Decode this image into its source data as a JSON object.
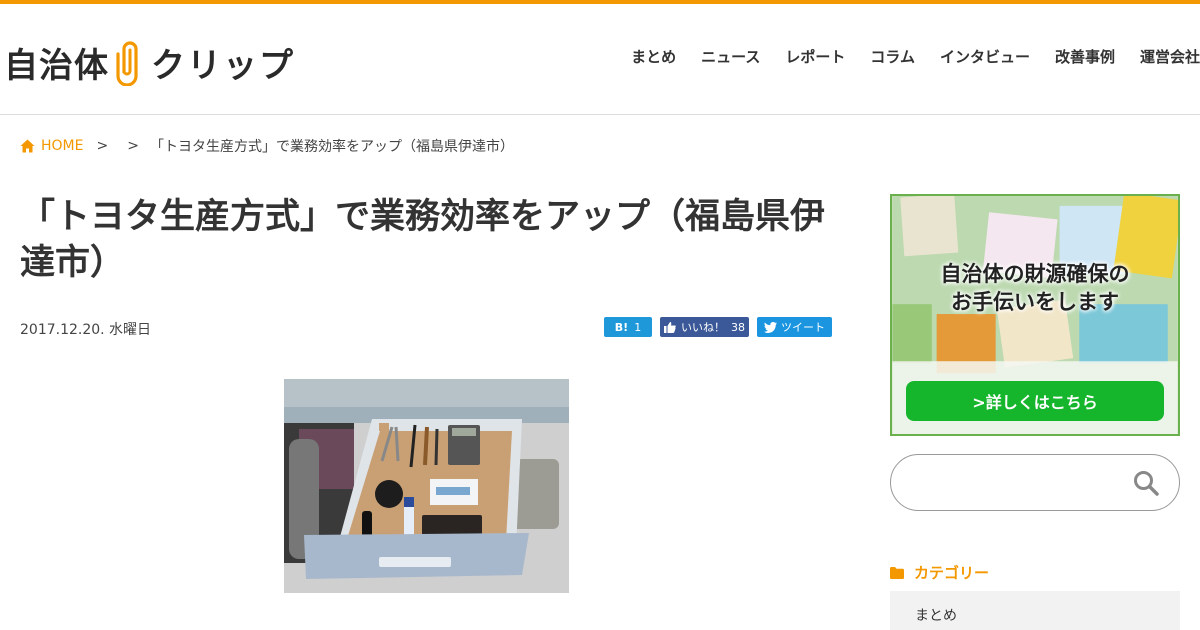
{
  "site": {
    "logo_text_1": "自治体",
    "logo_text_2": "クリップ",
    "accent_color": "#f39800"
  },
  "nav": {
    "items": [
      "まとめ",
      "ニュース",
      "レポート",
      "コラム",
      "インタビュー",
      "改善事例",
      "運営会社"
    ]
  },
  "breadcrumb": {
    "home": "HOME",
    "sep": ">",
    "current": "「トヨタ生産方式」で業務効率をアップ（福島県伊達市）"
  },
  "article": {
    "title": "「トヨタ生産方式」で業務効率をアップ（福島県伊達市）",
    "date": "2017.12.20. 水曜日"
  },
  "share": {
    "hatena_label": "B!",
    "hatena_count": "1",
    "fb_label": "いいね！",
    "fb_count": "38",
    "tw_label": "ツイート"
  },
  "sidebar": {
    "banner_line1": "自治体の財源確保の",
    "banner_line2": "お手伝いをします",
    "banner_button": ">詳しくはこちら",
    "search_placeholder": "",
    "category_heading": "カテゴリー",
    "category_first": "まとめ"
  }
}
